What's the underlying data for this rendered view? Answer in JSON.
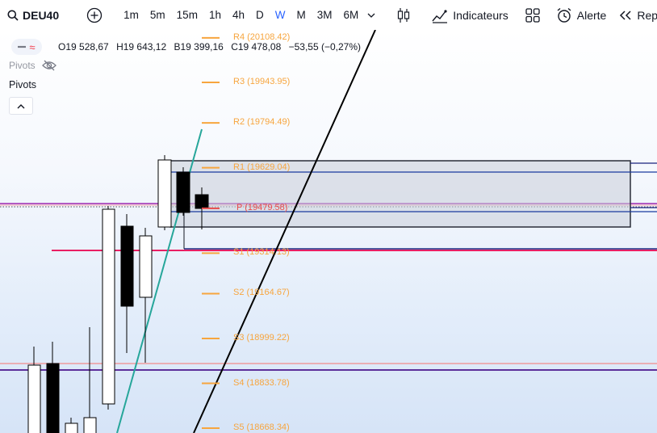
{
  "toolbar": {
    "symbol": "DEU40",
    "intervals": [
      "1m",
      "5m",
      "15m",
      "1h",
      "4h",
      "D",
      "W",
      "M",
      "3M",
      "6M"
    ],
    "active_interval": "W",
    "indicators_label": "Indicateurs",
    "alert_label": "Alerte",
    "replay_label": "Replay"
  },
  "legend": {
    "open": "O19 528,67",
    "high": "H19 643,12",
    "low": "B19 399,16",
    "close": "C19 478,08",
    "change": "−53,55 (−0,27%)",
    "change_color": "#131722"
  },
  "indicator": {
    "pivots_name": "Pivots",
    "pivots_title": "Pivots"
  },
  "pivot_levels": [
    {
      "label": "R4 (20108.42)",
      "value": 20108.42
    },
    {
      "label": "R3 (19943.95)",
      "value": 19943.95
    },
    {
      "label": "R2 (19794.49)",
      "value": 19794.49
    },
    {
      "label": "R1 (19629.04)",
      "value": 19629.04
    },
    {
      "label": "P (19479.58)",
      "value": 19479.58
    },
    {
      "label": "S1 (19314.13)",
      "value": 19314.13
    },
    {
      "label": "S2 (19164.67)",
      "value": 19164.67
    },
    {
      "label": "S3 (18999.22)",
      "value": 18999.22
    },
    {
      "label": "S4 (18833.78)",
      "value": 18833.78
    },
    {
      "label": "S5 (18668.34)",
      "value": 18668.34
    }
  ],
  "colors": {
    "pivot": "#f7a53e",
    "pivot_p": "#e84a4a",
    "active": "#2962ff",
    "trend_black": "#000000",
    "trend_teal": "#26a69a",
    "zone_border": "#2a2e39",
    "zone_fill": "#d1d4dc"
  }
}
